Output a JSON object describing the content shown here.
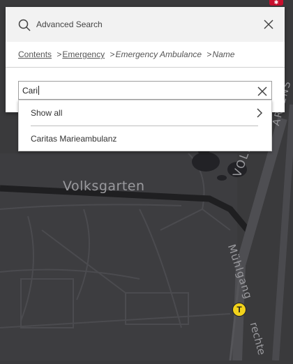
{
  "map": {
    "labels": {
      "volksgarten": "Volksgarten",
      "volksgartenstrasse": "VOLKSGARTENST",
      "muhlgang": "Mühlgang",
      "recht": "rechte",
      "gartens": "ARTENS"
    },
    "transit_stop_symbol": "T",
    "colors": {
      "background": "#3a3a3c",
      "road": "#4a4a4e",
      "highlight_road": "#1f1f21",
      "water": "#222226",
      "transit_stop": "#f2d21b"
    }
  },
  "search_panel": {
    "title": "Advanced Search",
    "breadcrumb": {
      "links": [
        "Contents",
        "Emergency"
      ],
      "current": [
        "Emergency Ambulance",
        "Name"
      ],
      "separator": ">"
    },
    "search": {
      "value": "Cari"
    },
    "dropdown": {
      "show_all_label": "Show all",
      "results": [
        "Caritas Marieambulanz"
      ]
    }
  },
  "icons": {
    "search": "search-icon",
    "close": "close-icon",
    "clear": "clear-icon",
    "chevron": "chevron-right-icon"
  }
}
